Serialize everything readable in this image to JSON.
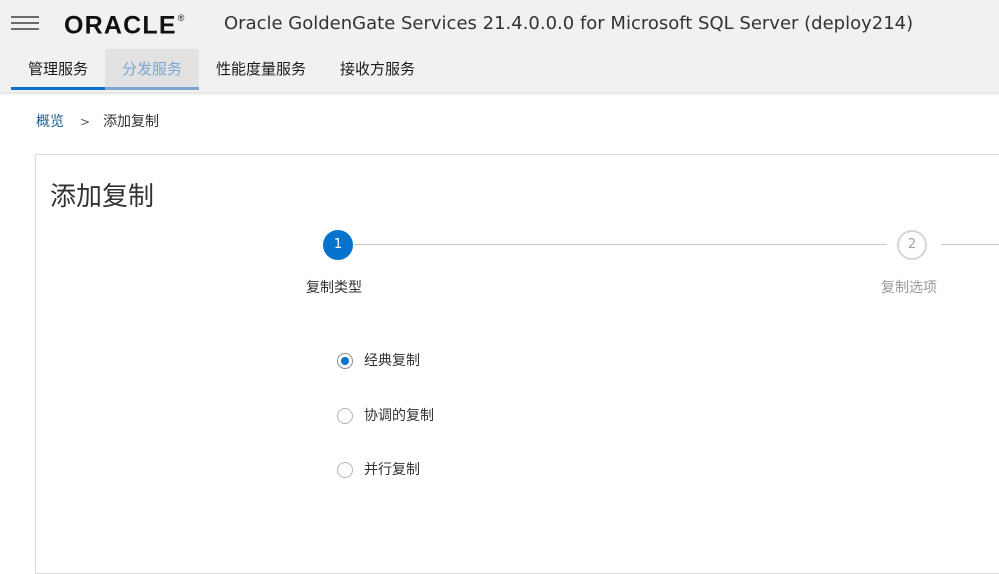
{
  "header": {
    "logo_text": "ORACLE",
    "logo_mark": "®",
    "app_title": "Oracle GoldenGate Services 21.4.0.0.0 for Microsoft SQL Server (deploy214)",
    "menu_icon": "hamburger-menu-icon",
    "tabs": [
      {
        "label": "管理服务",
        "state": "active"
      },
      {
        "label": "分发服务",
        "state": "hover"
      },
      {
        "label": "性能度量服务",
        "state": "normal"
      },
      {
        "label": "接收方服务",
        "state": "normal"
      }
    ]
  },
  "breadcrumb": {
    "parent": "概览",
    "separator": ">",
    "current": "添加复制"
  },
  "wizard": {
    "title": "添加复制",
    "steps": [
      {
        "number": "1",
        "label": "复制类型",
        "state": "active"
      },
      {
        "number": "2",
        "label": "复制选项",
        "state": "inactive"
      }
    ],
    "options": [
      {
        "label": "经典复制",
        "checked": true
      },
      {
        "label": "协调的复制",
        "checked": false
      },
      {
        "label": "并行复制",
        "checked": false
      }
    ]
  },
  "colors": {
    "accent": "#0572ce",
    "tab_hover": "#7aa6cf",
    "header_bg": "#f1f1f1",
    "link": "#1c5f95"
  }
}
